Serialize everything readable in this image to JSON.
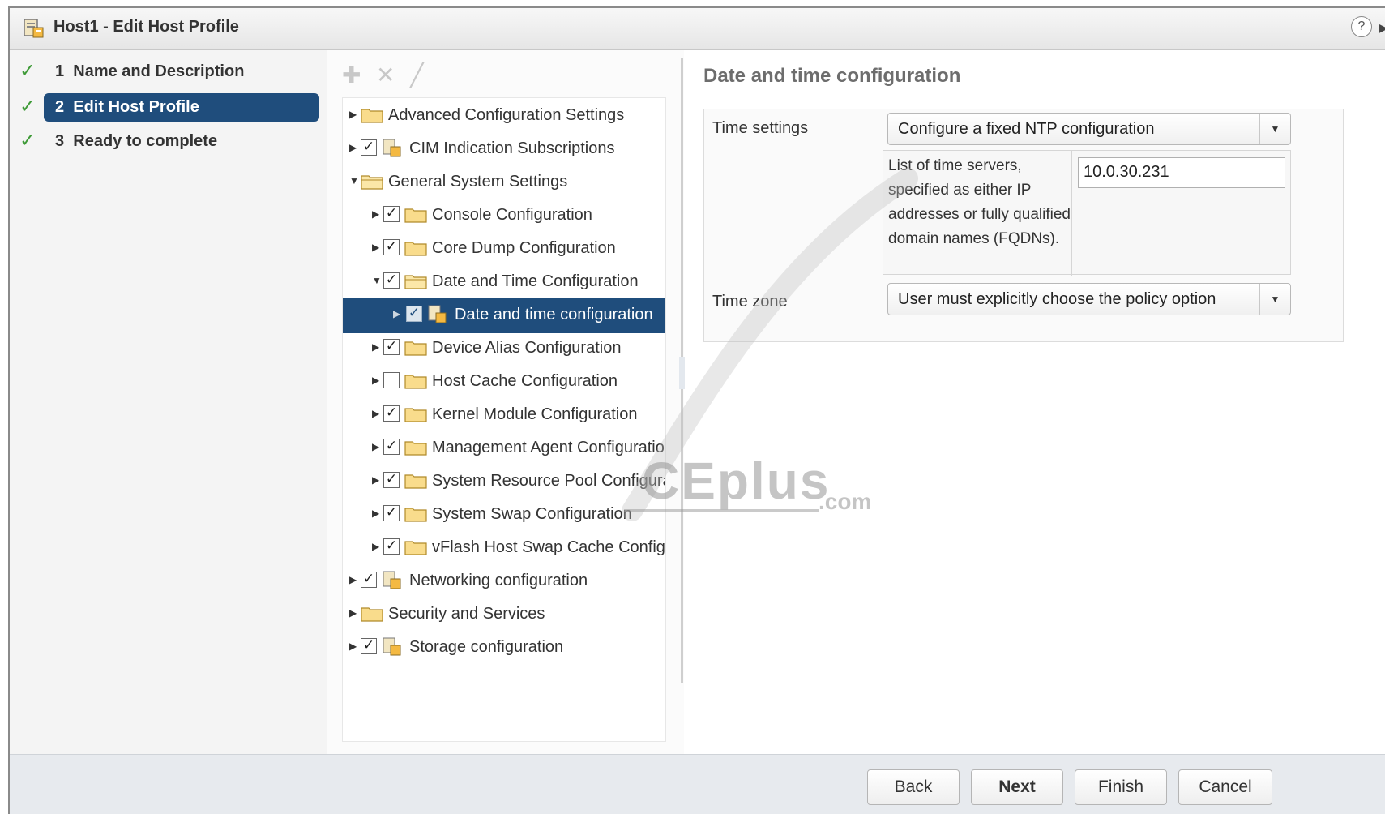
{
  "window": {
    "title": "Host1 - Edit Host Profile",
    "help_glyph": "?"
  },
  "steps": [
    {
      "number": "1",
      "label": "Name and Description",
      "done": true
    },
    {
      "number": "2",
      "label": "Edit Host Profile",
      "done": true,
      "active": true
    },
    {
      "number": "3",
      "label": "Ready to complete",
      "done": true
    }
  ],
  "tree": {
    "toolbar": [
      "add-icon",
      "remove-icon",
      "edit-icon"
    ],
    "items": [
      {
        "label": "Advanced Configuration Settings"
      },
      {
        "label": "CIM Indication Subscriptions"
      },
      {
        "label": "General System Settings"
      },
      {
        "label": "Console Configuration"
      },
      {
        "label": "Core Dump Configuration"
      },
      {
        "label": "Date and Time Configuration"
      },
      {
        "label": "Date and time configuration"
      },
      {
        "label": "Device Alias Configuration"
      },
      {
        "label": "Host Cache Configuration"
      },
      {
        "label": "Kernel Module Configuration"
      },
      {
        "label": "Management Agent Configuration"
      },
      {
        "label": "System Resource Pool Configuration"
      },
      {
        "label": "System Swap Configuration"
      },
      {
        "label": "vFlash Host Swap Cache Configuration"
      },
      {
        "label": "Networking configuration"
      },
      {
        "label": "Security and Services"
      },
      {
        "label": "Storage configuration"
      }
    ]
  },
  "content": {
    "title": "Date and time configuration",
    "time_settings": {
      "label": "Time settings",
      "value": "Configure a fixed NTP configuration",
      "servers_description": "List of time servers, specified as either IP addresses or fully qualified domain names (FQDNs).",
      "servers_value": "10.0.30.231"
    },
    "time_zone": {
      "label": "Time zone",
      "value": "User must explicitly choose the policy option"
    }
  },
  "watermark": {
    "text": "CEplus",
    "suffix": ".com"
  },
  "footer": {
    "back": "Back",
    "next": "Next",
    "finish": "Finish",
    "cancel": "Cancel"
  },
  "colors": {
    "accent": "#1f4d7c",
    "check": "#3e9a37",
    "footer_bg": "#e7eaee"
  }
}
